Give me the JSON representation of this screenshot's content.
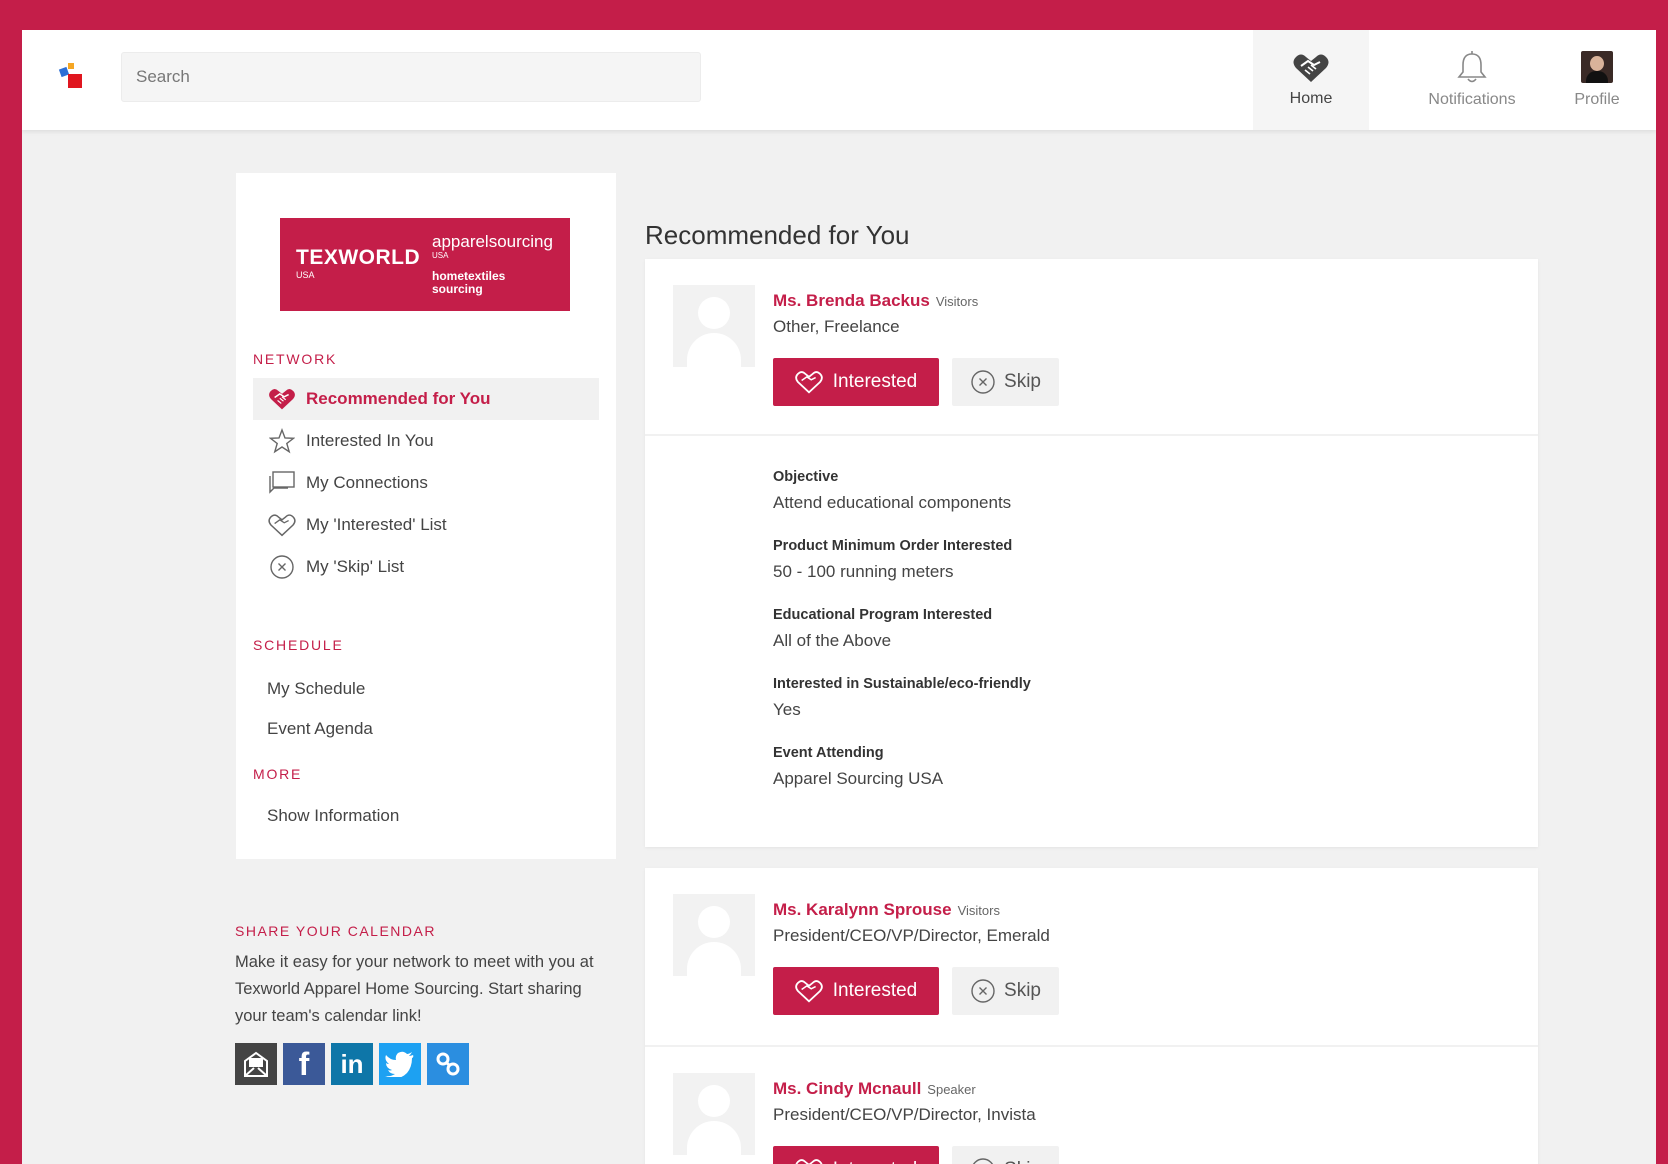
{
  "header": {
    "search_placeholder": "Search",
    "nav": {
      "home": "Home",
      "notifications": "Notifications",
      "profile": "Profile"
    }
  },
  "sidebar": {
    "brand": {
      "texworld": "TEXWORLD",
      "texworld_sub": "USA",
      "apparel": "apparelsourcing",
      "apparel_sub": "USA",
      "home1": "hometextiles",
      "home2": "sourcing"
    },
    "network_title": "NETWORK",
    "network_items": [
      {
        "label": "Recommended for You",
        "icon": "handshake-icon",
        "active": true
      },
      {
        "label": "Interested In You",
        "icon": "star-icon"
      },
      {
        "label": "My Connections",
        "icon": "chat-icon"
      },
      {
        "label": "My 'Interested' List",
        "icon": "handshake-outline-icon"
      },
      {
        "label": "My 'Skip' List",
        "icon": "x-circle-icon"
      }
    ],
    "schedule_title": "SCHEDULE",
    "schedule_items": [
      "My Schedule",
      "Event Agenda"
    ],
    "more_title": "MORE",
    "more_items": [
      "Show Information"
    ]
  },
  "share": {
    "title": "SHARE YOUR CALENDAR",
    "text": "Make it easy for your network to meet with you at Texworld Apparel Home Sourcing. Start sharing your team's calendar link!",
    "icons": [
      "email-icon",
      "facebook-icon",
      "linkedin-icon",
      "twitter-icon",
      "link-icon"
    ]
  },
  "main": {
    "title": "Recommended for You",
    "buttons": {
      "interested": "Interested",
      "skip": "Skip"
    },
    "people": [
      {
        "name": "Ms. Brenda Backus",
        "type": "Visitors",
        "role": "Other, Freelance",
        "details": [
          {
            "label": "Objective",
            "value": "Attend educational components"
          },
          {
            "label": "Product Minimum Order Interested",
            "value": "50 - 100 running meters"
          },
          {
            "label": "Educational Program Interested",
            "value": "All of the Above"
          },
          {
            "label": "Interested in Sustainable/eco-friendly",
            "value": "Yes"
          },
          {
            "label": "Event Attending",
            "value": "Apparel Sourcing USA"
          }
        ]
      },
      {
        "name": "Ms. Karalynn Sprouse",
        "type": "Visitors",
        "role": "President/CEO/VP/Director, Emerald"
      },
      {
        "name": "Ms. Cindy Mcnaull",
        "type": "Speaker",
        "role": "President/CEO/VP/Director, Invista"
      }
    ]
  },
  "colors": {
    "brand": "#c41e49",
    "background": "#f1f1f1",
    "facebook": "#3b5998",
    "linkedin": "#0e76a8",
    "twitter": "#1da1f2",
    "link": "#2b8ee0",
    "email": "#444444"
  }
}
